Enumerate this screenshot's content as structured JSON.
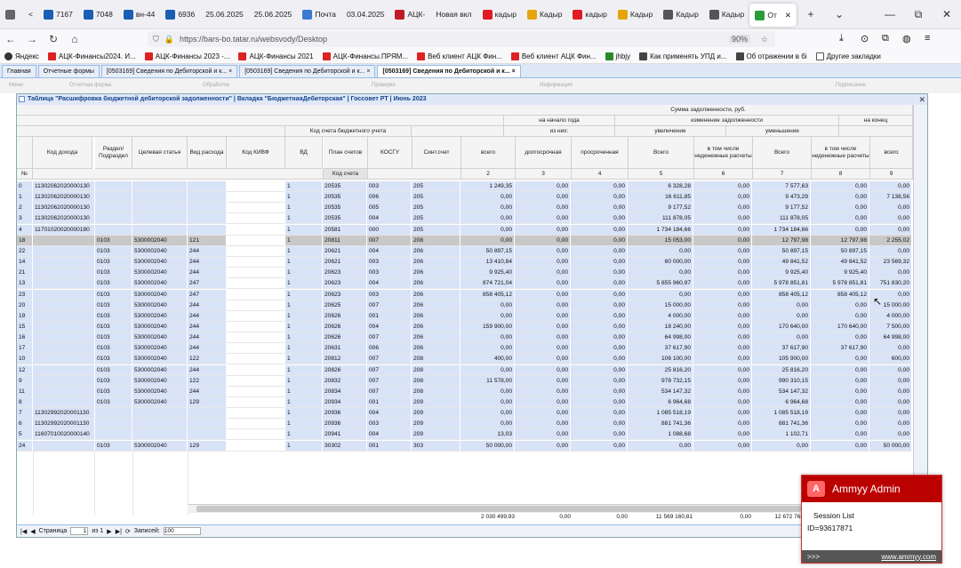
{
  "browser": {
    "tabs": [
      {
        "label": "",
        "icon": "tab-list-icon"
      },
      {
        "label": "<",
        "icon": ""
      },
      {
        "label": "7167",
        "icon": "doc-icon"
      },
      {
        "label": "7048",
        "icon": "doc-icon"
      },
      {
        "label": "вн-44",
        "icon": "doc-icon"
      },
      {
        "label": "6936",
        "icon": "doc-icon"
      },
      {
        "label": "25.06.2025",
        "icon": ""
      },
      {
        "label": "25.06.2025",
        "icon": ""
      },
      {
        "label": "Почта",
        "icon": "mail-icon"
      },
      {
        "label": "03.04.2025",
        "icon": ""
      },
      {
        "label": "АЦК-",
        "icon": "ack-icon"
      },
      {
        "label": "Новая вкл",
        "icon": ""
      },
      {
        "label": "кадыр",
        "icon": "yandex-icon"
      },
      {
        "label": "Кадыр",
        "icon": "mountain-icon"
      },
      {
        "label": "кадыр",
        "icon": "yandex-icon"
      },
      {
        "label": "Кадыр",
        "icon": "mountain-icon"
      },
      {
        "label": "Кадыр",
        "icon": "museum-icon"
      },
      {
        "label": "Кадыр",
        "icon": "museum-icon"
      },
      {
        "label": "От",
        "icon": "chrome-icon",
        "active": true
      }
    ],
    "url": "https://bars-bo.tatar.ru/websvody/Desktop",
    "url_host": "bars-bo.tatar.ru",
    "zoom": "90%",
    "bookmarks": [
      "Яндекс",
      "АЦК-Финансы2024. И...",
      "АЦК-Финансы 2023 -...",
      "АЦК-Финансы 2021",
      "АЦК-Финансы.ПРЯМ...",
      "Веб клиент АЦК Фин...",
      "Веб клиент АЦК Фин...",
      "jhbjy",
      "Как применять УПД и...",
      "Об отражении в бі",
      "Другие закладки"
    ]
  },
  "app": {
    "tabs": [
      {
        "label": "Главная",
        "active": false
      },
      {
        "label": "Отчетные формы",
        "active": false
      },
      {
        "label": "[0503169] Сведения по Дебиторской и к...",
        "active": false
      },
      {
        "label": "[0503169] Сведения по Дебиторской и к...",
        "active": false
      },
      {
        "label": "[0503169] Сведения по Дебиторской и к...",
        "active": true
      }
    ],
    "menu": [
      "Меню",
      "Отчетная форма",
      "Обработки",
      "Проверки",
      "Информация",
      "Подписание"
    ],
    "window_title": "Таблица \"Расшифровка бюджетной дебиторской задолженности\" | Вкладка \"БюджетнаяДебиторская\" | Госсовет РТ | Июнь 2023"
  },
  "grid": {
    "header": {
      "sum_group": "Сумма задолженности, руб.",
      "na_nachalo": "на начало года",
      "iz_nih": "из них:",
      "izmenenie": "изменение задолженности",
      "uvelichenie": "увеличение",
      "umenshenie": "уменьшение",
      "na_konec": "на конец",
      "kod_scheta": "Код счета бюджетного учета",
      "kod_scheta_sub": "Код счета",
      "no": "№",
      "cols": [
        "Код дохода",
        "Раздел/ Подраздел",
        "Целевая статья",
        "Вид расхода",
        "Код КИВФ",
        "ВД",
        "План счетов",
        "КОСГУ",
        "Синт.счет",
        "всего",
        "долгосрочная",
        "просроченная",
        "Всего",
        "в том числе неденежные расчеты",
        "Всего",
        "в том числе неденежные расчеты",
        "всего",
        "д"
      ],
      "nums": [
        "2",
        "3",
        "4",
        "5",
        "6",
        "7",
        "8",
        "9"
      ]
    },
    "rows": [
      {
        "n": "0",
        "kd": "11302062020000130",
        "rp": "",
        "cs": "",
        "vr": "",
        "vd": "1",
        "ps": "20535",
        "ko": "003",
        "ss": "205",
        "c2": "1 249,35",
        "c3": "0,00",
        "c4": "0,00",
        "c5": "6 328,28",
        "c6": "0,00",
        "c7": "7 577,63",
        "c8": "0,00",
        "c9": "0,00",
        "bg": "blue"
      },
      {
        "n": "1",
        "kd": "11302062020000130",
        "rp": "",
        "cs": "",
        "vr": "",
        "vd": "1",
        "ps": "20535",
        "ko": "006",
        "ss": "205",
        "c2": "0,00",
        "c3": "0,00",
        "c4": "0,00",
        "c5": "16 611,85",
        "c6": "0,00",
        "c7": "9 473,29",
        "c8": "0,00",
        "c9": "7 138,56",
        "bg": "blue"
      },
      {
        "n": "2",
        "kd": "11302062020000130",
        "rp": "",
        "cs": "",
        "vr": "",
        "vd": "1",
        "ps": "20535",
        "ko": "005",
        "ss": "205",
        "c2": "0,00",
        "c3": "0,00",
        "c4": "0,00",
        "c5": "9 177,52",
        "c6": "0,00",
        "c7": "9 177,52",
        "c8": "0,00",
        "c9": "0,00",
        "bg": "blue"
      },
      {
        "n": "3",
        "kd": "11302062020000130",
        "rp": "",
        "cs": "",
        "vr": "",
        "vd": "1",
        "ps": "20535",
        "ko": "004",
        "ss": "205",
        "c2": "0,00",
        "c3": "0,00",
        "c4": "0,00",
        "c5": "111 878,05",
        "c6": "0,00",
        "c7": "111 878,05",
        "c8": "0,00",
        "c9": "0,00",
        "bg": "blue"
      },
      {
        "n": "4",
        "kd": "11701020020000180",
        "rp": "",
        "cs": "",
        "vr": "",
        "vd": "1",
        "ps": "20581",
        "ko": "000",
        "ss": "205",
        "c2": "0,00",
        "c3": "0,00",
        "c4": "0,00",
        "c5": "1 734 184,66",
        "c6": "0,00",
        "c7": "1 734 184,66",
        "c8": "0,00",
        "c9": "0,00",
        "bg": "blue"
      },
      {
        "n": "18",
        "kd": "",
        "rp": "0103",
        "cs": "5300002040",
        "vr": "121",
        "vd": "1",
        "ps": "20811",
        "ko": "007",
        "ss": "208",
        "c2": "0,00",
        "c3": "0,00",
        "c4": "0,00",
        "c5": "15 053,00",
        "c6": "0,00",
        "c7": "12 797,98",
        "c8": "12 797,98",
        "c9": "2 255,02",
        "bg": "gray"
      },
      {
        "n": "22",
        "kd": "",
        "rp": "0103",
        "cs": "5300002040",
        "vr": "244",
        "vd": "1",
        "ps": "20621",
        "ko": "004",
        "ss": "206",
        "c2": "50 897,15",
        "c3": "0,00",
        "c4": "0,00",
        "c5": "0,00",
        "c6": "0,00",
        "c7": "50 897,15",
        "c8": "50 897,15",
        "c9": "0,00",
        "bg": "blue"
      },
      {
        "n": "14",
        "kd": "",
        "rp": "0103",
        "cs": "5300002040",
        "vr": "244",
        "vd": "1",
        "ps": "20621",
        "ko": "003",
        "ss": "206",
        "c2": "13 410,84",
        "c3": "0,00",
        "c4": "0,00",
        "c5": "60 000,00",
        "c6": "0,00",
        "c7": "49 841,52",
        "c8": "49 841,52",
        "c9": "23 569,32",
        "bg": "blue"
      },
      {
        "n": "21",
        "kd": "",
        "rp": "0103",
        "cs": "5300002040",
        "vr": "244",
        "vd": "1",
        "ps": "20623",
        "ko": "003",
        "ss": "206",
        "c2": "9 925,40",
        "c3": "0,00",
        "c4": "0,00",
        "c5": "0,00",
        "c6": "0,00",
        "c7": "9 925,40",
        "c8": "9 925,40",
        "c9": "0,00",
        "bg": "blue"
      },
      {
        "n": "13",
        "kd": "",
        "rp": "0103",
        "cs": "5300002040",
        "vr": "247",
        "vd": "1",
        "ps": "20623",
        "ko": "004",
        "ss": "206",
        "c2": "874 721,04",
        "c3": "0,00",
        "c4": "0,00",
        "c5": "5 855 960,97",
        "c6": "0,00",
        "c7": "5 978 851,81",
        "c8": "5 978 851,81",
        "c9": "751 830,20",
        "bg": "blue"
      },
      {
        "n": "23",
        "kd": "",
        "rp": "0103",
        "cs": "5300002040",
        "vr": "247",
        "vd": "1",
        "ps": "20623",
        "ko": "003",
        "ss": "206",
        "c2": "858 405,12",
        "c3": "0,00",
        "c4": "0,00",
        "c5": "0,00",
        "c6": "0,00",
        "c7": "858 405,12",
        "c8": "858 405,12",
        "c9": "0,00",
        "bg": "blue"
      },
      {
        "n": "20",
        "kd": "",
        "rp": "0103",
        "cs": "5300002040",
        "vr": "244",
        "vd": "1",
        "ps": "20625",
        "ko": "007",
        "ss": "206",
        "c2": "0,00",
        "c3": "0,00",
        "c4": "0,00",
        "c5": "15 000,00",
        "c6": "0,00",
        "c7": "0,00",
        "c8": "0,00",
        "c9": "15 000,00",
        "bg": "blue"
      },
      {
        "n": "19",
        "kd": "",
        "rp": "0103",
        "cs": "5300002040",
        "vr": "244",
        "vd": "1",
        "ps": "20626",
        "ko": "001",
        "ss": "206",
        "c2": "0,00",
        "c3": "0,00",
        "c4": "0,00",
        "c5": "4 000,00",
        "c6": "0,00",
        "c7": "0,00",
        "c8": "0,00",
        "c9": "4 000,00",
        "bg": "blue"
      },
      {
        "n": "15",
        "kd": "",
        "rp": "0103",
        "cs": "5300002040",
        "vr": "244",
        "vd": "1",
        "ps": "20626",
        "ko": "004",
        "ss": "206",
        "c2": "159 900,00",
        "c3": "0,00",
        "c4": "0,00",
        "c5": "18 240,00",
        "c6": "0,00",
        "c7": "170 640,00",
        "c8": "170 640,00",
        "c9": "7 500,00",
        "bg": "blue"
      },
      {
        "n": "16",
        "kd": "",
        "rp": "0103",
        "cs": "5300002040",
        "vr": "244",
        "vd": "1",
        "ps": "20626",
        "ko": "007",
        "ss": "206",
        "c2": "0,00",
        "c3": "0,00",
        "c4": "0,00",
        "c5": "64 998,00",
        "c6": "0,00",
        "c7": "0,00",
        "c8": "0,00",
        "c9": "64 998,00",
        "bg": "blue"
      },
      {
        "n": "17",
        "kd": "",
        "rp": "0103",
        "cs": "5300002040",
        "vr": "244",
        "vd": "1",
        "ps": "20631",
        "ko": "006",
        "ss": "206",
        "c2": "0,00",
        "c3": "0,00",
        "c4": "0,00",
        "c5": "37 617,90",
        "c6": "0,00",
        "c7": "37 617,90",
        "c8": "37 617,90",
        "c9": "0,00",
        "bg": "blue"
      },
      {
        "n": "10",
        "kd": "",
        "rp": "0103",
        "cs": "5300002040",
        "vr": "122",
        "vd": "1",
        "ps": "20812",
        "ko": "007",
        "ss": "208",
        "c2": "400,00",
        "c3": "0,00",
        "c4": "0,00",
        "c5": "106 100,00",
        "c6": "0,00",
        "c7": "105 900,00",
        "c8": "0,00",
        "c9": "600,00",
        "bg": "blue"
      },
      {
        "n": "12",
        "kd": "",
        "rp": "0103",
        "cs": "5300002040",
        "vr": "244",
        "vd": "1",
        "ps": "20826",
        "ko": "007",
        "ss": "208",
        "c2": "0,00",
        "c3": "0,00",
        "c4": "0,00",
        "c5": "25 816,20",
        "c6": "0,00",
        "c7": "25 816,20",
        "c8": "0,00",
        "c9": "0,00",
        "bg": "blue"
      },
      {
        "n": "9",
        "kd": "",
        "rp": "0103",
        "cs": "5300002040",
        "vr": "122",
        "vd": "1",
        "ps": "20832",
        "ko": "007",
        "ss": "208",
        "c2": "11 578,00",
        "c3": "0,00",
        "c4": "0,00",
        "c5": "978 732,15",
        "c6": "0,00",
        "c7": "990 310,15",
        "c8": "0,00",
        "c9": "0,00",
        "bg": "blue"
      },
      {
        "n": "11",
        "kd": "",
        "rp": "0103",
        "cs": "5300002040",
        "vr": "244",
        "vd": "1",
        "ps": "20834",
        "ko": "007",
        "ss": "208",
        "c2": "0,00",
        "c3": "0,00",
        "c4": "0,00",
        "c5": "534 147,32",
        "c6": "0,00",
        "c7": "534 147,32",
        "c8": "0,00",
        "c9": "0,00",
        "bg": "blue"
      },
      {
        "n": "8",
        "kd": "",
        "rp": "0103",
        "cs": "5300002040",
        "vr": "129",
        "vd": "1",
        "ps": "20934",
        "ko": "001",
        "ss": "209",
        "c2": "0,00",
        "c3": "0,00",
        "c4": "0,00",
        "c5": "6 964,68",
        "c6": "0,00",
        "c7": "6 964,68",
        "c8": "0,00",
        "c9": "0,00",
        "bg": "blue"
      },
      {
        "n": "7",
        "kd": "11302992020001130",
        "rp": "",
        "cs": "",
        "vr": "",
        "vd": "1",
        "ps": "20936",
        "ko": "004",
        "ss": "209",
        "c2": "0,00",
        "c3": "0,00",
        "c4": "0,00",
        "c5": "1 085 518,19",
        "c6": "0,00",
        "c7": "1 085 518,19",
        "c8": "0,00",
        "c9": "0,00",
        "bg": "blue"
      },
      {
        "n": "6",
        "kd": "11302992020001130",
        "rp": "",
        "cs": "",
        "vr": "",
        "vd": "1",
        "ps": "20936",
        "ko": "003",
        "ss": "209",
        "c2": "0,00",
        "c3": "0,00",
        "c4": "0,00",
        "c5": "881 741,36",
        "c6": "0,00",
        "c7": "881 741,36",
        "c8": "0,00",
        "c9": "0,00",
        "bg": "blue"
      },
      {
        "n": "5",
        "kd": "11607010020000140",
        "rp": "",
        "cs": "",
        "vr": "",
        "vd": "1",
        "ps": "20941",
        "ko": "004",
        "ss": "209",
        "c2": "13,03",
        "c3": "0,00",
        "c4": "0,00",
        "c5": "1 088,68",
        "c6": "0,00",
        "c7": "1 102,71",
        "c8": "0,00",
        "c9": "0,00",
        "bg": "blue"
      },
      {
        "n": "24",
        "kd": "",
        "rp": "0103",
        "cs": "5300002040",
        "vr": "129",
        "vd": "1",
        "ps": "30302",
        "ko": "001",
        "ss": "303",
        "c2": "50 000,00",
        "c3": "0,00",
        "c4": "0,00",
        "c5": "0,00",
        "c6": "0,00",
        "c7": "0,00",
        "c8": "0,00",
        "c9": "50 000,00",
        "bg": "blue"
      }
    ],
    "totals": {
      "c2": "2 030 499,93",
      "c3": "0,00",
      "c4": "0,00",
      "c5": "11 569 160,81",
      "c6": "0,00",
      "c7": "12 672 768,04"
    }
  },
  "pager": {
    "page_label": "Страница",
    "page": "1",
    "of": "из 1",
    "records_label": "Записей:",
    "records": "100"
  },
  "ammyy": {
    "title": "Ammyy Admin",
    "session": "Session List",
    "id": "ID=93617871",
    "more": ">>>",
    "link": "www.ammyy.com"
  }
}
